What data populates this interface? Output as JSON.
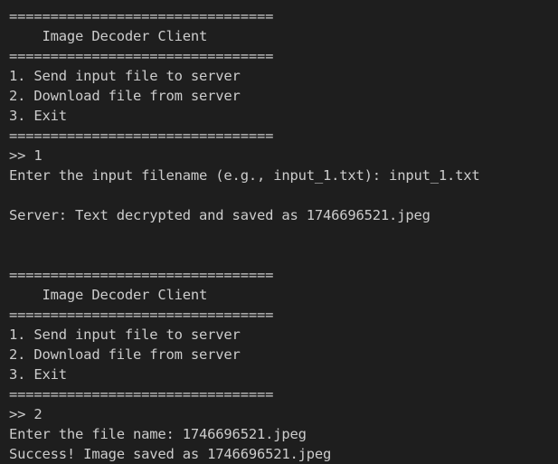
{
  "terminal": {
    "lines": [
      "================================",
      "    Image Decoder Client",
      "================================",
      "1. Send input file to server",
      "2. Download file from server",
      "3. Exit",
      "================================",
      ">> 1",
      "Enter the input filename (e.g., input_1.txt): input_1.txt",
      "",
      "Server: Text decrypted and saved as 1746696521.jpeg",
      "",
      "",
      "================================",
      "    Image Decoder Client",
      "================================",
      "1. Send input file to server",
      "2. Download file from server",
      "3. Exit",
      "================================",
      ">> 2",
      "Enter the file name: 1746696521.jpeg",
      "Success! Image saved as 1746696521.jpeg"
    ]
  }
}
